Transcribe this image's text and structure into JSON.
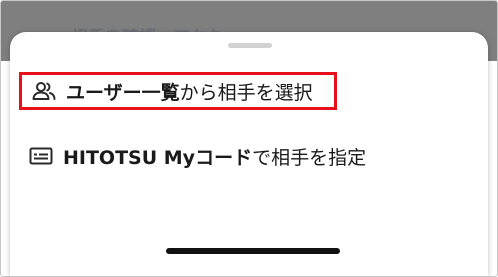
{
  "backdrop": {
    "partial_text": "相手を確認・アクター"
  },
  "sheet": {
    "items": [
      {
        "icon": "users-icon",
        "bold_label": "ユーザー一覧",
        "normal_label": "から相手を選択",
        "highlighted": true,
        "highlight_color": "#e8101a"
      },
      {
        "icon": "id-card-icon",
        "bold_label": "HITOTSU Myコード",
        "normal_label": "で相手を指定",
        "highlighted": false
      }
    ]
  }
}
